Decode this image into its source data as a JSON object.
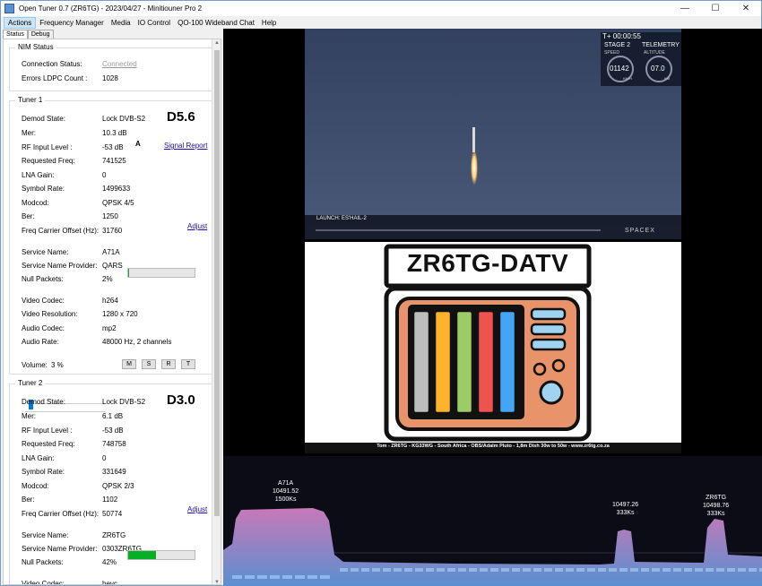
{
  "window": {
    "title": "Open Tuner 0.7 (ZR6TG) - 2023/04/27 - Minitiouner Pro 2",
    "minimize": "—",
    "maximize": "☐",
    "close": "✕"
  },
  "menu": [
    "Actions",
    "Frequency Manager",
    "Media",
    "IO Control",
    "QO-100 Wideband Chat",
    "Help"
  ],
  "tabs": [
    "Status",
    "Debug"
  ],
  "nim": {
    "title": "NIM Status",
    "connection_label": "Connection Status:",
    "connection_value": "Connected",
    "errors_label": "Errors LDPC Count :",
    "errors_value": "1028"
  },
  "tuner1": {
    "title": "Tuner 1",
    "big": "D5.6",
    "marker": "A",
    "signal_report": "Signal Report",
    "adjust": "Adjust",
    "null_fill": 0.02,
    "rows": [
      {
        "label": "Demod State:",
        "value": "Lock DVB-S2"
      },
      {
        "label": "Mer:",
        "value": "10.3 dB"
      },
      {
        "label": "RF Input Level :",
        "value": "-53 dB"
      },
      {
        "label": "Requested Freq:",
        "value": "741525"
      },
      {
        "label": "LNA Gain:",
        "value": "0"
      },
      {
        "label": "Symbol Rate:",
        "value": "1499633"
      },
      {
        "label": "Modcod:",
        "value": "QPSK 4/5"
      },
      {
        "label": "Ber:",
        "value": "1250"
      },
      {
        "label": "Freq Carrier Offset (Hz):",
        "value": "31760"
      },
      {
        "label": "Service Name:",
        "value": "A71A"
      },
      {
        "label": "Service Name Provider:",
        "value": "QARS"
      },
      {
        "label": "Null Packets:",
        "value": "2%"
      },
      {
        "label": "Video Codec:",
        "value": "h264"
      },
      {
        "label": "Video Resolution:",
        "value": "1280 x 720"
      },
      {
        "label": "Audio Codec:",
        "value": "mp2"
      },
      {
        "label": "Audio Rate:",
        "value": "48000 Hz, 2 channels"
      }
    ],
    "volume_label": "Volume:",
    "volume_value": "3 %",
    "volume_level": 0.03,
    "buttons": [
      "M",
      "S",
      "R",
      "T"
    ]
  },
  "tuner2": {
    "title": "Tuner 2",
    "big": "D3.0",
    "adjust": "Adjust",
    "null_fill": 0.42,
    "rows": [
      {
        "label": "Demod State:",
        "value": "Lock DVB-S2"
      },
      {
        "label": "Mer:",
        "value": "6.1 dB"
      },
      {
        "label": "RF Input Level :",
        "value": "-53 dB"
      },
      {
        "label": "Requested Freq:",
        "value": "748758"
      },
      {
        "label": "LNA Gain:",
        "value": "0"
      },
      {
        "label": "Symbol Rate:",
        "value": "331649"
      },
      {
        "label": "Modcod:",
        "value": "QPSK 2/3"
      },
      {
        "label": "Ber:",
        "value": "1102"
      },
      {
        "label": "Freq Carrier Offset (Hz):",
        "value": "50774"
      },
      {
        "label": "Service Name:",
        "value": "ZR6TG"
      },
      {
        "label": "Service Name Provider:",
        "value": "0303ZR6TG"
      },
      {
        "label": "Null Packets:",
        "value": "42%"
      },
      {
        "label": "Video Codec:",
        "value": "hevc"
      }
    ]
  },
  "video1": {
    "timer": "T+ 00:00:55",
    "stage": "STAGE 2",
    "telemetry": "TELEMETRY",
    "speed_label": "SPEED",
    "altitude_label": "ALTITUDE",
    "speed_value": "01142",
    "speed_unit": "KM/H",
    "altitude_value": "07.0",
    "altitude_unit": "KM",
    "launch": "LAUNCH: ES'HAIL-2",
    "brand": "SPACEX"
  },
  "video2": {
    "title": "ZR6TG-DATV",
    "footer": "Tom - ZR6TG - KG33WG - South Africa - OBS/Adalm Pluto - 1,8m Dish 30w to 50w - www.zr6tg.co.za",
    "stripe_colors": [
      "#bdbdbd",
      "#ffb22b",
      "#9ccc65",
      "#ef5350",
      "#42a5f5"
    ]
  },
  "spectrum": {
    "signals": [
      {
        "lines": [
          "A71A",
          "10491.52",
          "1500Ks"
        ]
      },
      {
        "lines": [
          "10497.26",
          "333Ks"
        ]
      },
      {
        "lines": [
          "ZR6TG",
          "10498.76",
          "333Ks"
        ]
      }
    ]
  }
}
